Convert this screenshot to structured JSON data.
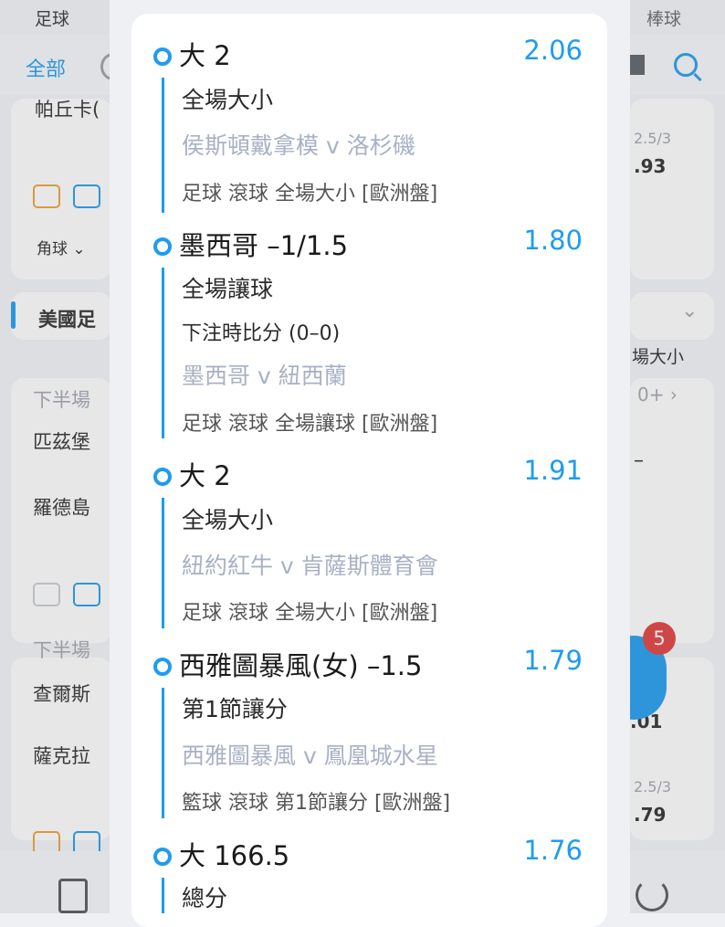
{
  "background": {
    "top_left": "足球",
    "top_right": "棒球",
    "nav_all": "全部",
    "rows": [
      {
        "text": "帕丘卡("
      },
      {
        "text": "角球 ⌄"
      },
      {
        "text": "美國足"
      },
      {
        "text": "下半場"
      },
      {
        "text": "匹茲堡"
      },
      {
        "text": "羅德島"
      },
      {
        "text": "下半場"
      },
      {
        "text": "查爾斯"
      },
      {
        "text": "薩克拉"
      }
    ],
    "right_snippets": [
      "2.5/3",
      ".93",
      "場大小",
      "0+ ›",
      "–",
      "2.5/3",
      ".79",
      ".01"
    ],
    "badge_count": "5",
    "colors": {
      "accent": "#1e9cf0",
      "badge": "#e23b3b"
    }
  },
  "bets": [
    {
      "selection": "大 2",
      "odds": "2.06",
      "market": "全場大小",
      "score": "",
      "match": "侯斯頓戴拿模 v 洛杉磯",
      "meta": "足球 滾球  全場大小 [歐洲盤]"
    },
    {
      "selection": "墨西哥 –1/1.5",
      "odds": "1.80",
      "market": "全場讓球",
      "score": "下注時比分 (0–0)",
      "match": "墨西哥 v 紐西蘭",
      "meta": "足球 滾球  全場讓球 [歐洲盤]"
    },
    {
      "selection": "大 2",
      "odds": "1.91",
      "market": "全場大小",
      "score": "",
      "match": "紐約紅牛 v 肯薩斯體育會",
      "meta": "足球 滾球  全場大小 [歐洲盤]"
    },
    {
      "selection": "西雅圖暴風(女) –1.5",
      "odds": "1.79",
      "market": "第1節讓分",
      "score": "",
      "match": "西雅圖暴風 v 鳳凰城水星",
      "meta": "籃球 滾球  第1節讓分 [歐洲盤]"
    },
    {
      "selection": "大 166.5",
      "odds": "1.76",
      "market": "總分",
      "score": "",
      "match": "",
      "meta": ""
    }
  ]
}
